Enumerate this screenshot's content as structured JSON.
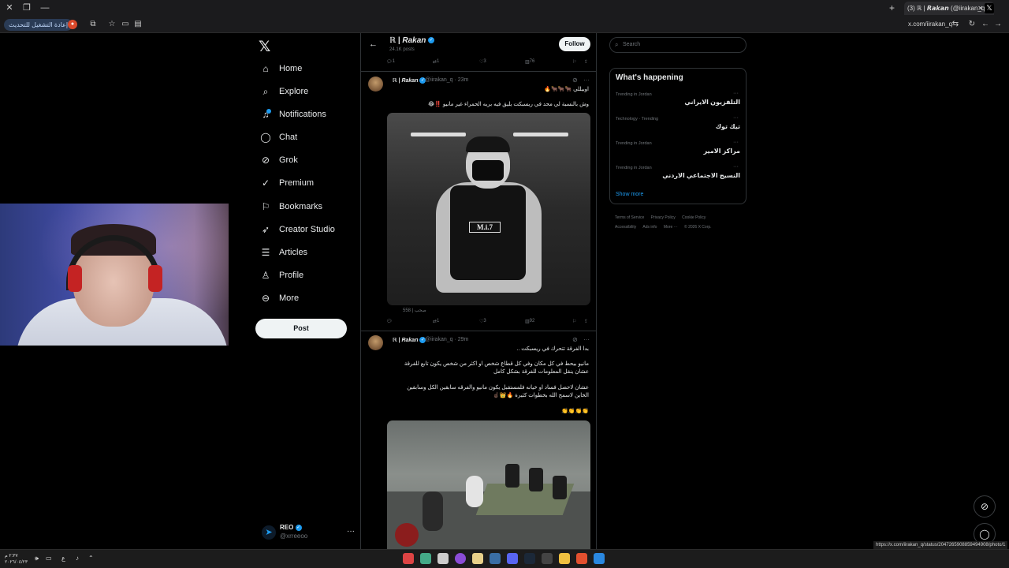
{
  "browser": {
    "tab_title": "(3) ℝ | 𝙍𝙖𝙠𝙖𝙣 (@iirakan_q) / X",
    "relaunch_label": "إعادة التشغيل للتحديث",
    "url": "x.com/iirakan_q",
    "status_link": "https://x.com/iirakan_q/status/2047265908859494908/photo/1"
  },
  "nav": {
    "items": [
      {
        "label": "Home",
        "icon": "home-icon"
      },
      {
        "label": "Explore",
        "icon": "search-icon"
      },
      {
        "label": "Notifications",
        "icon": "bell-icon"
      },
      {
        "label": "Chat",
        "icon": "chat-icon"
      },
      {
        "label": "Grok",
        "icon": "grok-icon"
      },
      {
        "label": "Premium",
        "icon": "premium-icon"
      },
      {
        "label": "Bookmarks",
        "icon": "bookmark-icon"
      },
      {
        "label": "Creator Studio",
        "icon": "rocket-icon"
      },
      {
        "label": "Articles",
        "icon": "article-icon"
      },
      {
        "label": "Profile",
        "icon": "person-icon"
      },
      {
        "label": "More",
        "icon": "more-circle-icon"
      }
    ],
    "post_label": "Post",
    "account": {
      "name": "REO",
      "handle": "@xrreeoo"
    }
  },
  "profile": {
    "name": "ℝ | Rakan",
    "posts": "24.1K posts",
    "follow_label": "Follow"
  },
  "top_actions": {
    "replies": "1",
    "reposts": "1",
    "likes": "3",
    "views": "76"
  },
  "tweets": [
    {
      "name": "ℝ | Rakan",
      "handle": "@iirakan_q · 23m",
      "line1": "اوبيللي 🐂🐂🐂🔥",
      "line2": "وش بالنسبة لي محد في ريسبكت يليق فيه بريه الحمراء غير مانيو ‼️😂",
      "image_label": "M.i.7",
      "image_caption": "558 | صحب",
      "replies": "",
      "reposts": "1",
      "likes": "3",
      "views": "92"
    },
    {
      "name": "ℝ | Rakan",
      "handle": "@iirakan_q · 29m",
      "line1": "بدا الفرقة تتحرك في ريسبكت ..",
      "line2": "مانيو بيحط في كل مكان وفي كل قطاع شخص او اكثر من شخص يكون تابع للفرقة",
      "line3": "عشان ينقل المعلومات للفرقة بشكل كامل",
      "line4": "عشان لاحصل فساد او خيانه فلمستقبل يكون مانيو والفرقه سابقين الكل وسابقين",
      "line5": "الخاين لاسمح الله بخطوات كثيرة 🔥👑☝🏿",
      "line6": "👏👏👏👏"
    }
  ],
  "sidebar": {
    "search_placeholder": "Search",
    "happening_title": "What's happening",
    "trends": [
      {
        "meta": "Trending in Jordan",
        "title": "التلفزيون الايراني"
      },
      {
        "meta": "Technology · Trending",
        "title": "تيك توك"
      },
      {
        "meta": "Trending in Jordan",
        "title": "مراكز الامير"
      },
      {
        "meta": "Trending in Jordan",
        "title": "النسيج الاجتماعي الاردني"
      }
    ],
    "show_more": "Show more",
    "footer": [
      "Terms of Service",
      "Privacy Policy",
      "Cookie Policy",
      "Accessibility",
      "Ads info",
      "More ···",
      "© 2026 X Corp."
    ]
  },
  "taskbar": {
    "time": "٢:٣٧ م",
    "date": "٢٠٢٦/٠٤/٢٣",
    "lang": "ع"
  },
  "colors": {
    "accent": "#1d9bf0",
    "background": "#000000",
    "border": "#2f3336",
    "muted": "#71767b"
  }
}
